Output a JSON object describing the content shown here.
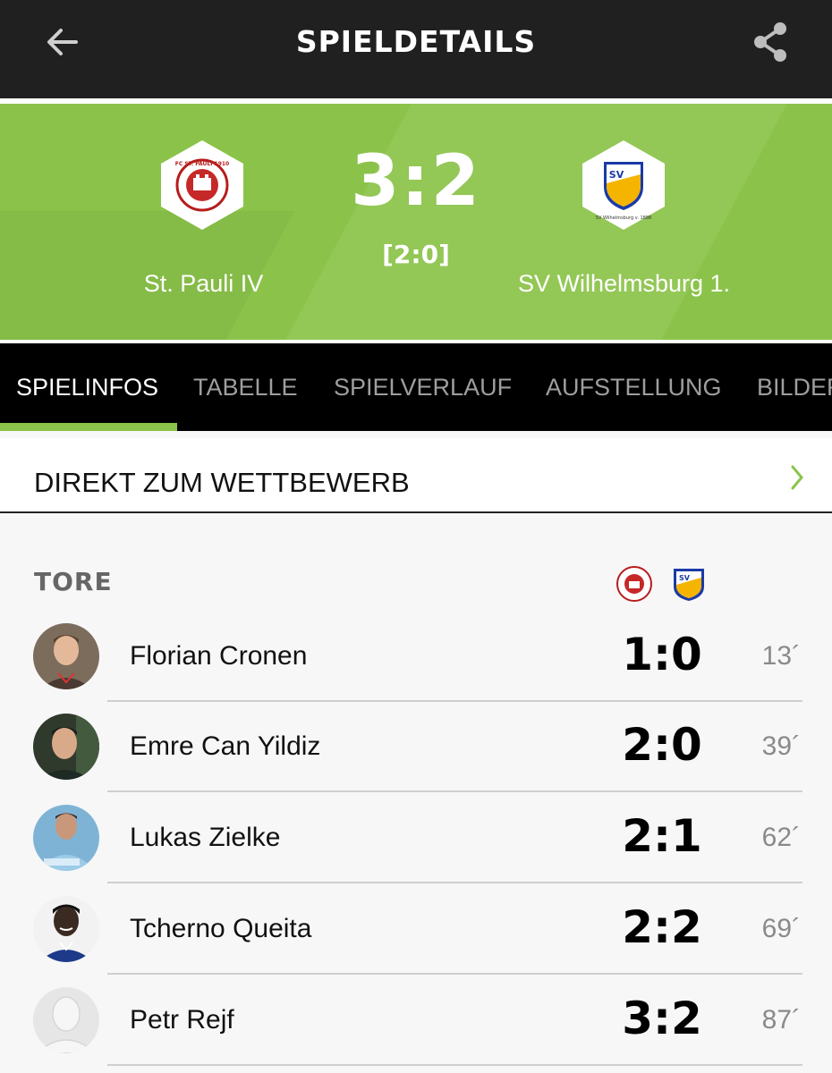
{
  "header": {
    "title": "SPIELDETAILS",
    "back_icon": "arrow-back-icon",
    "share_icon": "share-icon"
  },
  "match": {
    "home_team": "St. Pauli IV",
    "away_team": "SV Wilhelmsburg 1.",
    "score": "3:2",
    "halftime": "[2:0]",
    "home_logo_text": "FC ST. PAULI 1910",
    "away_logo_text": "SV Wilhelmsburg v. 1888",
    "colors": {
      "green": "#8bc34a",
      "dark": "#202020"
    }
  },
  "tabs": [
    {
      "label": "SPIELINFOS",
      "active": true
    },
    {
      "label": "TABELLE",
      "active": false
    },
    {
      "label": "SPIELVERLAUF",
      "active": false
    },
    {
      "label": "AUFSTELLUNG",
      "active": false
    },
    {
      "label": "BILDER",
      "active": false
    }
  ],
  "competition_link": {
    "label": "DIREKT ZUM WETTBEWERB",
    "icon": "chevron-right-icon"
  },
  "goals": {
    "title": "TORE",
    "items": [
      {
        "player": "Florian Cronen",
        "score": "1:0",
        "minute": "13´"
      },
      {
        "player": "Emre Can Yildiz",
        "score": "2:0",
        "minute": "39´"
      },
      {
        "player": "Lukas Zielke",
        "score": "2:1",
        "minute": "62´"
      },
      {
        "player": "Tcherno Queita",
        "score": "2:2",
        "minute": "69´"
      },
      {
        "player": "Petr Rejf",
        "score": "3:2",
        "minute": "87´"
      }
    ]
  }
}
